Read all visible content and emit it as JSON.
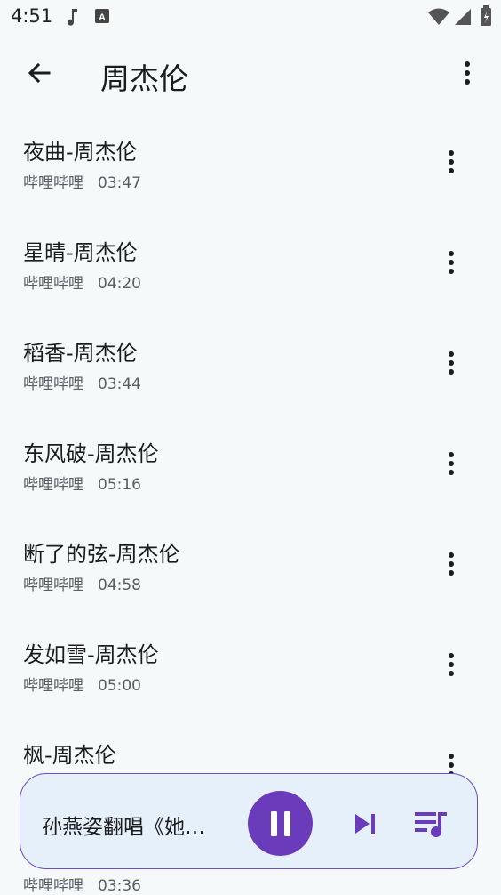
{
  "status_bar": {
    "time": "4:51",
    "icons": [
      "music-note-icon",
      "a-box-icon",
      "wifi-icon",
      "signal-icon",
      "battery-icon"
    ]
  },
  "app_bar": {
    "title": "周杰伦",
    "back_icon": "back-arrow-icon",
    "more_icon": "more-vert-icon"
  },
  "songs": [
    {
      "title": "夜曲-周杰伦",
      "source": "哔哩哔哩",
      "duration": "03:47"
    },
    {
      "title": "星晴-周杰伦",
      "source": "哔哩哔哩",
      "duration": "04:20"
    },
    {
      "title": "稻香-周杰伦",
      "source": "哔哩哔哩",
      "duration": "03:44"
    },
    {
      "title": "东风破-周杰伦",
      "source": "哔哩哔哩",
      "duration": "05:16"
    },
    {
      "title": "断了的弦-周杰伦",
      "source": "哔哩哔哩",
      "duration": "04:58"
    },
    {
      "title": "发如雪-周杰伦",
      "source": "哔哩哔哩",
      "duration": "05:00"
    },
    {
      "title": "枫-周杰伦",
      "source": "",
      "duration": ""
    }
  ],
  "peek_item": {
    "source": "哔哩哔哩",
    "duration": "03:36"
  },
  "mini_player": {
    "title": "孙燕姿翻唱《她…",
    "play_state": "playing",
    "pause_icon": "pause-icon",
    "next_icon": "skip-next-icon",
    "queue_icon": "queue-music-icon"
  },
  "colors": {
    "background": "#f6f9fa",
    "accent": "#6a3bbb",
    "player_bg": "#e6f0fb",
    "player_border": "#6a4cc6",
    "secondary_text": "#5a5d63"
  }
}
